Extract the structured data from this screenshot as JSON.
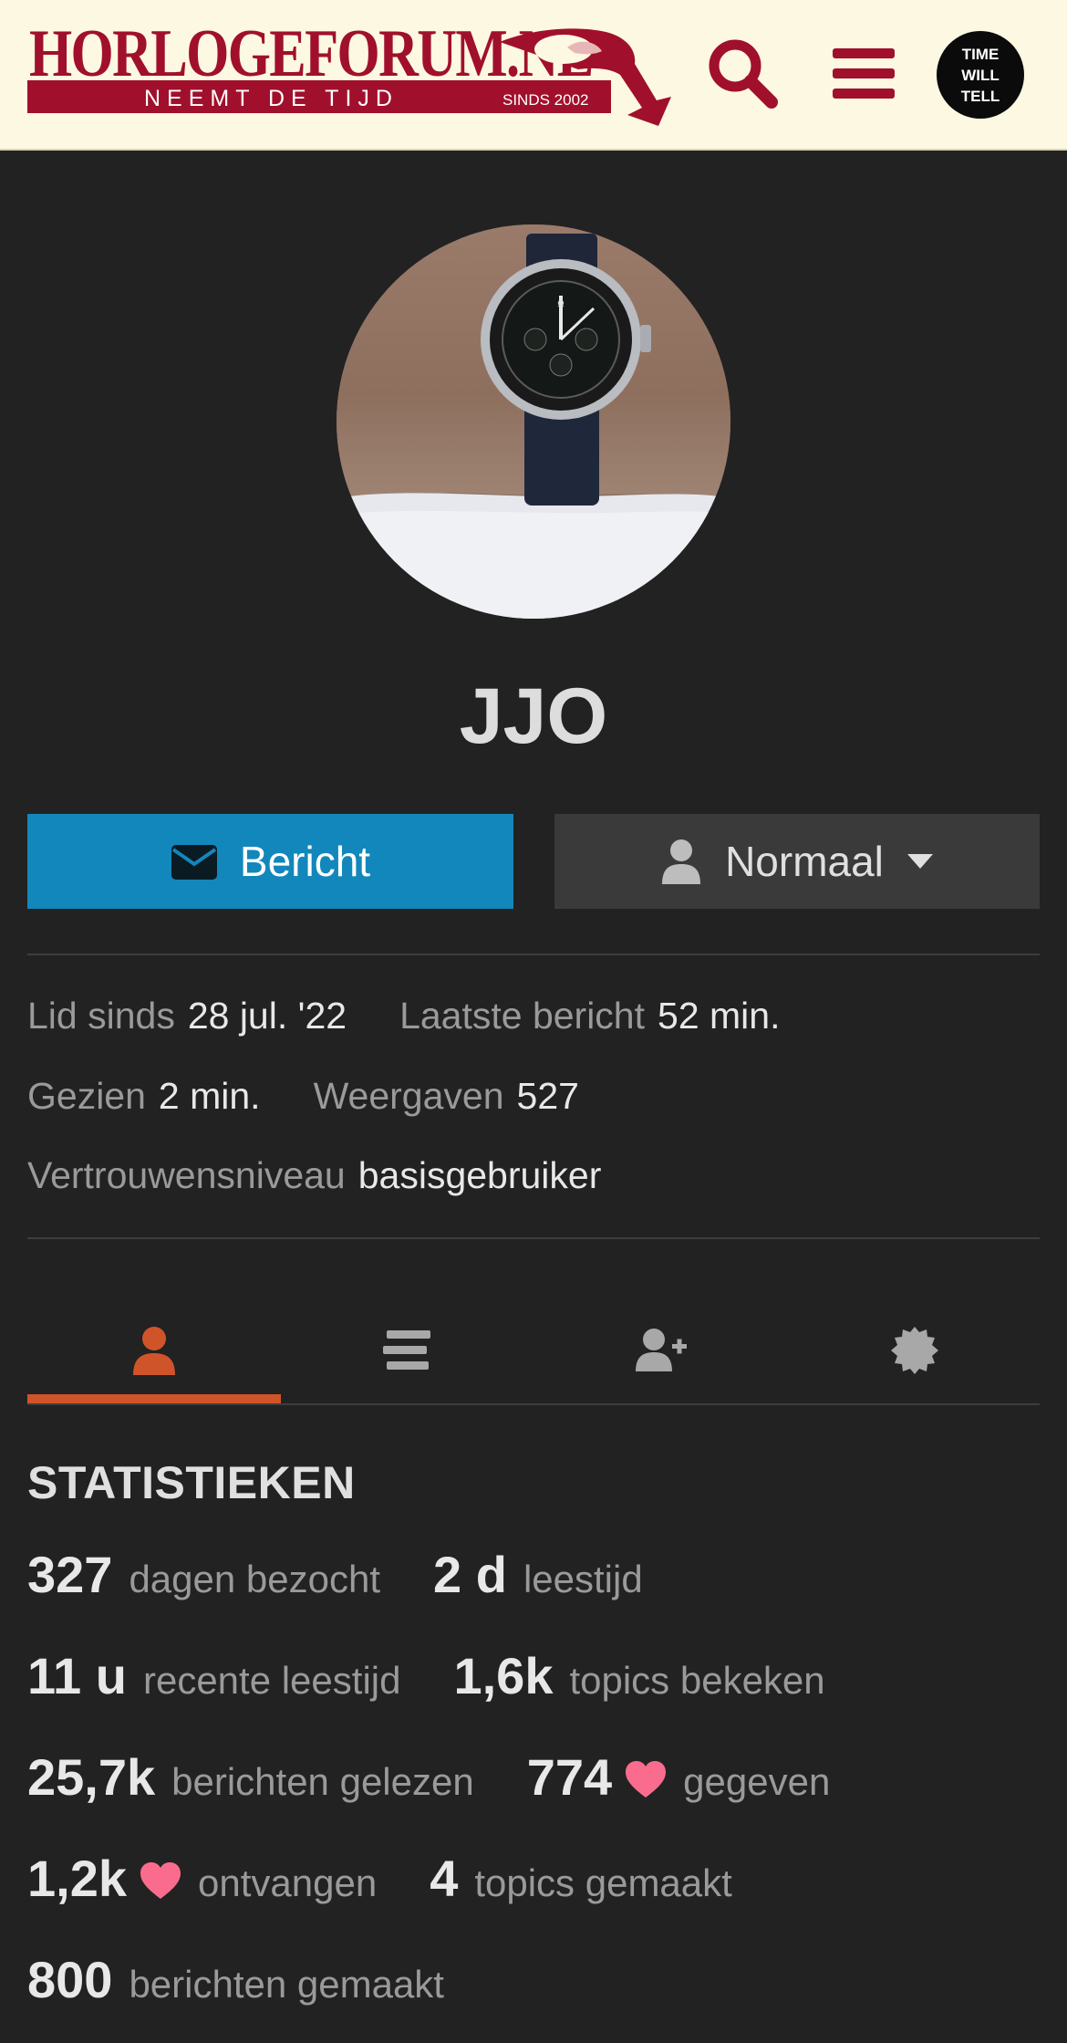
{
  "header": {
    "logo_title": "HORLOGEFORUM.NL",
    "logo_tagline": "NEEMT DE TIJD",
    "logo_since": "SINDS 2002",
    "badge_lines": [
      "TIME",
      "WILL",
      "TELL"
    ],
    "search_icon": "search-icon",
    "menu_icon": "hamburger-icon",
    "brand_color": "#a0102c"
  },
  "profile": {
    "username": "JJO",
    "avatar_icon": "user-avatar-watch-photo"
  },
  "actions": {
    "message_label": "Bericht",
    "message_icon": "envelope-icon",
    "notification_label": "Normaal",
    "notification_icon": "user-icon",
    "accent_color": "#1287bb"
  },
  "meta": {
    "member_since_label": "Lid sinds",
    "member_since_value": "28 jul. '22",
    "last_post_label": "Laatste bericht",
    "last_post_value": "52 min.",
    "seen_label": "Gezien",
    "seen_value": "2 min.",
    "views_label": "Weergaven",
    "views_value": "527",
    "trust_label": "Vertrouwensniveau",
    "trust_value": "basisgebruiker"
  },
  "tabs": [
    {
      "icon": "user-icon",
      "active": true
    },
    {
      "icon": "list-icon",
      "active": false
    },
    {
      "icon": "user-plus-icon",
      "active": false
    },
    {
      "icon": "badge-icon",
      "active": false
    }
  ],
  "tab_active_color": "#d0542a",
  "stats": {
    "title": "STATISTIEKEN",
    "days_visited_value": "327",
    "days_visited_label": "dagen bezocht",
    "read_time_value": "2 d",
    "read_time_label": "leestijd",
    "recent_read_value": "11 u",
    "recent_read_label": "recente leestijd",
    "topics_viewed_value": "1,6k",
    "topics_viewed_label": "topics bekeken",
    "posts_read_value": "25,7k",
    "posts_read_label": "berichten gelezen",
    "likes_given_value": "774",
    "likes_given_label": "gegeven",
    "likes_received_value": "1,2k",
    "likes_received_label": "ontvangen",
    "topics_created_value": "4",
    "topics_created_label": "topics gemaakt",
    "posts_created_value": "800",
    "posts_created_label": "berichten gemaakt",
    "heart_color": "#fa6c8d"
  }
}
